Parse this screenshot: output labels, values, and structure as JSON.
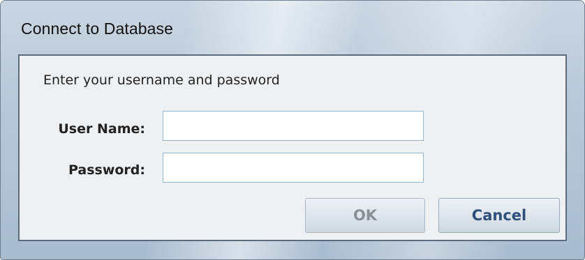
{
  "dialog": {
    "title": "Connect to Database",
    "prompt": "Enter your username and password",
    "username": {
      "label": "User Name:",
      "value": "",
      "placeholder": ""
    },
    "password": {
      "label": "Password:",
      "value": "",
      "placeholder": ""
    },
    "buttons": {
      "ok_label": "OK",
      "ok_enabled": false,
      "cancel_label": "Cancel"
    }
  },
  "colors": {
    "title_bar": "#b8c8d8",
    "client_background": "#eef0f2",
    "field_border": "#8fb5d8",
    "cancel_text": "#2f4f7a",
    "ok_text_disabled": "#8a8f94"
  }
}
